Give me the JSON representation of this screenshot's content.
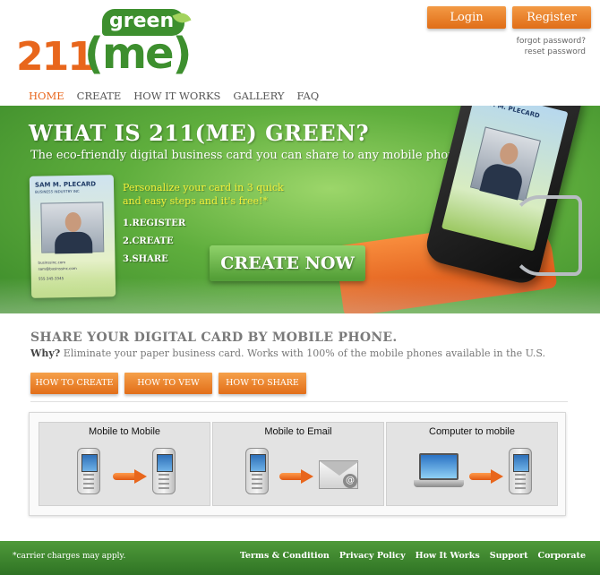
{
  "header": {
    "logo_number": "211",
    "logo_me": "(me)",
    "logo_green": "green",
    "login_label": "Login",
    "register_label": "Register",
    "forgot_password": "forgot password?",
    "reset_password": "reset password"
  },
  "nav": {
    "items": [
      {
        "label": "HOME",
        "active": true
      },
      {
        "label": "CREATE"
      },
      {
        "label": "HOW IT WORKS"
      },
      {
        "label": "GALLERY"
      },
      {
        "label": "FAQ"
      }
    ]
  },
  "hero": {
    "title": "WHAT IS 211(ME) GREEN?",
    "subtitle": "The eco-friendly digital business card you can share to any mobile phone",
    "steps_intro": "Personalize your card in 3 quick and easy steps and it's free!*",
    "steps": [
      "1.REGISTER",
      "2.CREATE",
      "3.SHARE"
    ],
    "cta_label": "CREATE NOW",
    "card_name": "SAM M. PLECARD",
    "card_company": "BUSINESS INDUSTRY INC",
    "card_lines": [
      "businssinc.com",
      "sam@businssinc.com",
      "555-345-3345"
    ],
    "phone_card_name": "SAM M. PLECARD"
  },
  "share": {
    "title": "SHARE YOUR DIGITAL CARD BY MOBILE PHONE.",
    "why_label": "Why?",
    "why_text": "Eliminate your paper business card. Works with 100% of the mobile phones available in the U.S.",
    "buttons": [
      "HOW TO CREATE",
      "HOW TO VEW",
      "HOW TO SHARE"
    ],
    "panels": [
      "Mobile to Mobile",
      "Mobile to Email",
      "Computer to mobile"
    ]
  },
  "footer": {
    "note": "*carrier charges may apply.",
    "links": [
      "Terms & Condition",
      "Privacy Policy",
      "How It Works",
      "Support",
      "Corporate"
    ]
  },
  "colors": {
    "brand_orange": "#e8661c",
    "brand_green": "#3d8f2e",
    "footer_green": "#3f8a2f"
  }
}
